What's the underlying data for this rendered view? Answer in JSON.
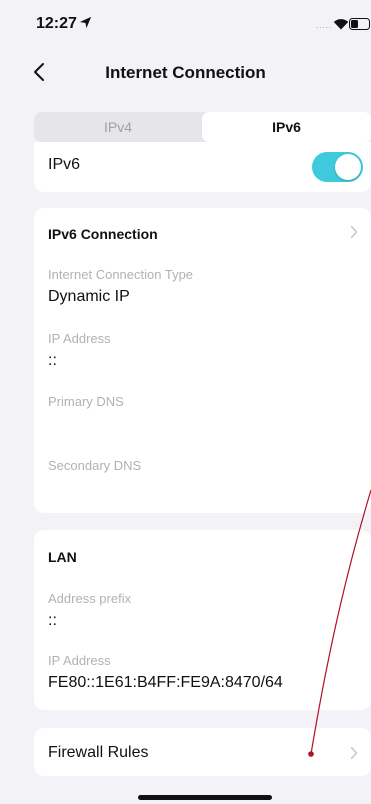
{
  "status_bar": {
    "time": "12:27",
    "signal": "....."
  },
  "nav": {
    "title": "Internet Connection"
  },
  "tabs": [
    {
      "label": "IPv4"
    },
    {
      "label": "IPv6"
    }
  ],
  "ipv6": {
    "label": "IPv6",
    "enabled": true
  },
  "connection": {
    "title": "IPv6 Connection",
    "fields": [
      {
        "label": "Internet Connection Type",
        "value": "Dynamic IP"
      },
      {
        "label": "IP Address",
        "value": "::"
      },
      {
        "label": "Primary DNS",
        "value": ""
      },
      {
        "label": "Secondary DNS",
        "value": ""
      }
    ]
  },
  "lan": {
    "title": "LAN",
    "fields": [
      {
        "label": "Address prefix",
        "value": "::"
      },
      {
        "label": "IP Address",
        "value": "FE80::1E61:B4FF:FE9A:8470/64"
      }
    ]
  },
  "firewall": {
    "label": "Firewall Rules"
  },
  "colors": {
    "toggle_on": "#3ec9dd",
    "annotation": "#b0102a",
    "background": "#f2f2f7"
  }
}
